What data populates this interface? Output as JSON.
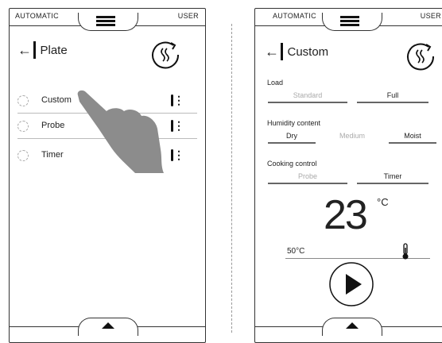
{
  "left": {
    "mode": "AUTOMATIC",
    "user": "USER",
    "title": "Plate",
    "options": [
      {
        "label": "Custom"
      },
      {
        "label": "Probe"
      },
      {
        "label": "Timer"
      }
    ]
  },
  "right": {
    "mode": "AUTOMATIC",
    "user": "USER",
    "title": "Custom",
    "load": {
      "label": "Load",
      "options": [
        "Standard",
        "Full"
      ],
      "selected": "Full"
    },
    "humidity": {
      "label": "Humidity content",
      "options": [
        "Dry",
        "Medium",
        "Moist"
      ],
      "selected": "Dry"
    },
    "cooking": {
      "label": "Cooking control",
      "options": [
        "Probe",
        "Timer"
      ],
      "selected": "Timer"
    },
    "temperature": "23",
    "temperature_unit": "°C",
    "probe_temp": "50°C"
  },
  "icons": [
    "menu-icon",
    "back-arrow-icon",
    "steam-icon",
    "kebab-icon",
    "chevron-up-icon",
    "thermometer-icon",
    "play-icon",
    "hand-pointer-icon"
  ]
}
